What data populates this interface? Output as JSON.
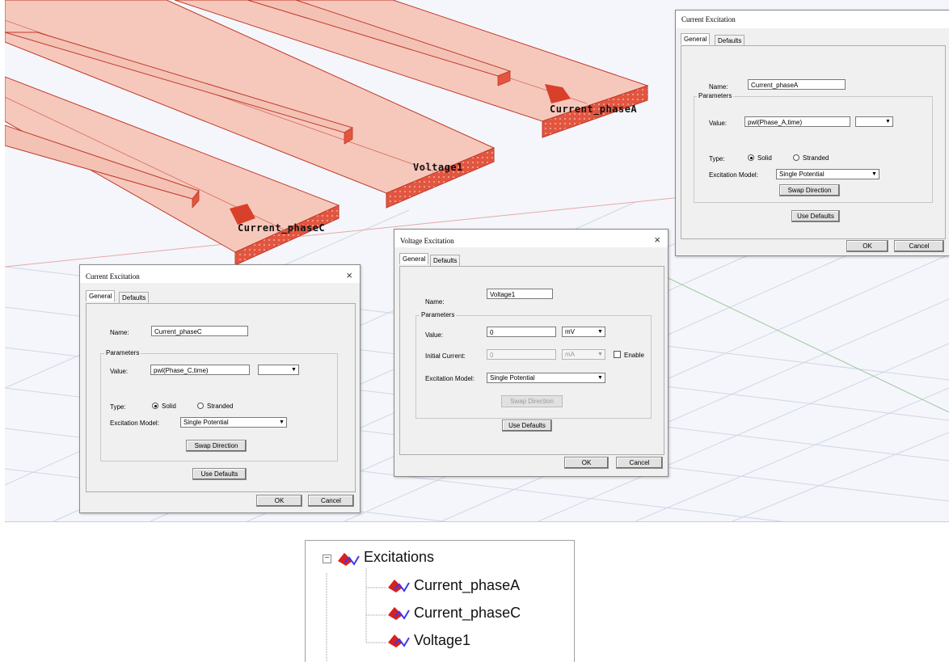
{
  "scene": {
    "labels": {
      "phase_a": "Current_phaseA",
      "phase_c": "Current_phaseC",
      "voltage": "Voltage1"
    }
  },
  "dialog_phase_a": {
    "title": "Current Excitation",
    "tabs": [
      "General",
      "Defaults"
    ],
    "name_label": "Name:",
    "name_value": "Current_phaseA",
    "parameters_label": "Parameters",
    "value_label": "Value:",
    "value_value": "pwl(Phase_A,time)",
    "unit_value": "",
    "type_label": "Type:",
    "type_options": [
      "Solid",
      "Stranded"
    ],
    "type_selected": "Solid",
    "model_label": "Excitation Model:",
    "model_value": "Single Potential",
    "swap_label": "Swap Direction",
    "defaults_label": "Use Defaults",
    "ok_label": "OK",
    "cancel_label": "Cancel"
  },
  "dialog_phase_c": {
    "title": "Current Excitation",
    "close_glyph": "×",
    "tabs": [
      "General",
      "Defaults"
    ],
    "name_label": "Name:",
    "name_value": "Current_phaseC",
    "parameters_label": "Parameters",
    "value_label": "Value:",
    "value_value": "pwl(Phase_C,time)",
    "unit_value": "",
    "type_label": "Type:",
    "type_options": [
      "Solid",
      "Stranded"
    ],
    "type_selected": "Solid",
    "model_label": "Excitation Model:",
    "model_value": "Single Potential",
    "swap_label": "Swap Direction",
    "defaults_label": "Use Defaults",
    "ok_label": "OK",
    "cancel_label": "Cancel"
  },
  "dialog_voltage": {
    "title": "Voltage Excitation",
    "close_glyph": "×",
    "tabs": [
      "General",
      "Defaults"
    ],
    "name_label": "Name:",
    "name_value": "Voltage1",
    "parameters_label": "Parameters",
    "value_label": "Value:",
    "value_value": "0",
    "value_unit": "mV",
    "initial_current_label": "Initial Current:",
    "initial_current_value": "0",
    "initial_current_unit": "mA",
    "enable_label": "Enable",
    "model_label": "Excitation Model:",
    "model_value": "Single Potential",
    "swap_label": "Swap Direction",
    "defaults_label": "Use Defaults",
    "ok_label": "OK",
    "cancel_label": "Cancel"
  },
  "tree": {
    "expander": "−",
    "root_label": "Excitations",
    "items": [
      "Current_phaseA",
      "Current_phaseC",
      "Voltage1"
    ]
  },
  "colors": {
    "conductor_fill": "#f6c8bb",
    "conductor_edge": "#c0392b",
    "end_face": "#e2553f",
    "arrow": "#d9402c",
    "grid_line": "#c9d3e6"
  }
}
